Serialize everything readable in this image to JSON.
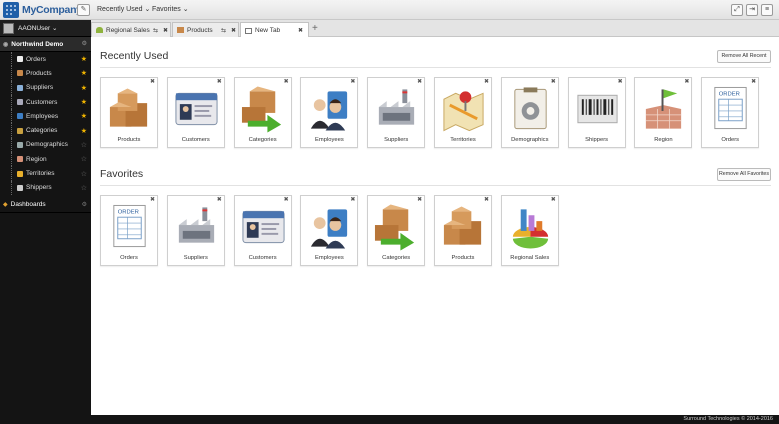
{
  "app": {
    "brand": "MyCompany",
    "footer": "Surround Technologies © 2014-2016"
  },
  "topmenu": [
    {
      "label": "Recently Used ⌄"
    },
    {
      "label": "Favorites ⌄"
    }
  ],
  "user": {
    "name": "AAONUser ⌄"
  },
  "sidebar": {
    "section": "Northwind Demo",
    "items": [
      {
        "label": "Orders",
        "icon": "orders-icon",
        "favorite": true
      },
      {
        "label": "Products",
        "icon": "products-icon",
        "favorite": true
      },
      {
        "label": "Suppliers",
        "icon": "suppliers-icon",
        "favorite": true
      },
      {
        "label": "Customers",
        "icon": "customers-icon",
        "favorite": true
      },
      {
        "label": "Employees",
        "icon": "employees-icon",
        "favorite": true
      },
      {
        "label": "Categories",
        "icon": "categories-icon",
        "favorite": true
      },
      {
        "label": "Demographics",
        "icon": "demographics-icon",
        "favorite": false
      },
      {
        "label": "Region",
        "icon": "region-icon",
        "favorite": false
      },
      {
        "label": "Territories",
        "icon": "territories-icon",
        "favorite": false
      },
      {
        "label": "Shippers",
        "icon": "shippers-icon",
        "favorite": false
      }
    ],
    "section2": "Dashboards"
  },
  "tabs": [
    {
      "label": "Regional Sales",
      "active": false
    },
    {
      "label": "Products",
      "active": false
    },
    {
      "label": "New Tab",
      "active": true
    }
  ],
  "recent": {
    "title": "Recently Used",
    "button": "Remove All Recent",
    "items": [
      "Products",
      "Customers",
      "Categories",
      "Employees",
      "Suppliers",
      "Territories",
      "Demographics",
      "Shippers",
      "Region",
      "Orders"
    ]
  },
  "favorites": {
    "title": "Favorites",
    "button": "Remove All Favorites",
    "items": [
      "Orders",
      "Suppliers",
      "Customers",
      "Employees",
      "Categories",
      "Products",
      "Regional Sales"
    ]
  },
  "colors": {
    "brand": "#2d5f9c",
    "star": "#f0b400",
    "sidebar": "#141414"
  }
}
